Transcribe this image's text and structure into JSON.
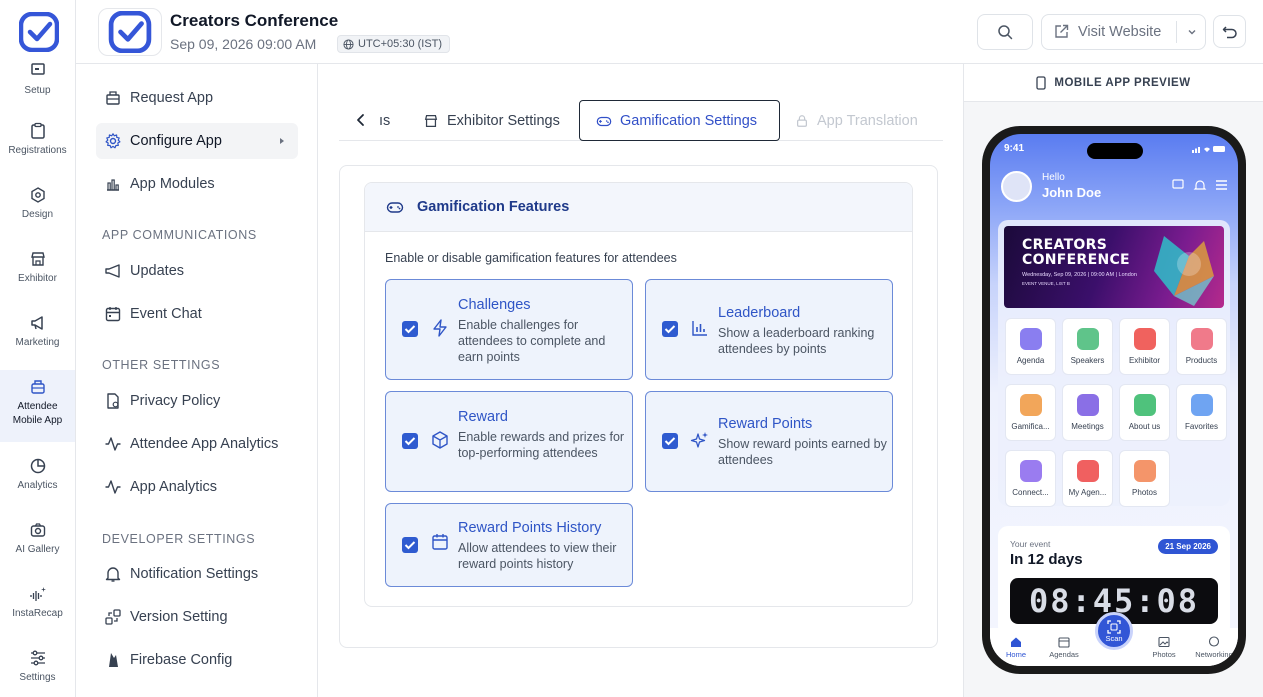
{
  "rail": {
    "items": [
      {
        "label": "Setup",
        "icon": "setup-icon"
      },
      {
        "label": "Registrations",
        "icon": "clipboard-icon"
      },
      {
        "label": "Design",
        "icon": "design-icon"
      },
      {
        "label": "Exhibitor",
        "icon": "store-icon"
      },
      {
        "label": "Marketing",
        "icon": "megaphone-icon"
      },
      {
        "label": "Attendee Mobile App",
        "label_line1": "Attendee",
        "label_line2": "Mobile App",
        "icon": "mobile-app-icon",
        "active": true
      },
      {
        "label": "Analytics",
        "icon": "pie-chart-icon"
      },
      {
        "label": "AI Gallery",
        "icon": "camera-icon"
      },
      {
        "label": "InstaRecap",
        "icon": "sparkle-wave-icon"
      },
      {
        "label": "Settings",
        "icon": "sliders-icon"
      }
    ]
  },
  "header": {
    "event_title": "Creators Conference",
    "event_datetime": "Sep 09, 2026 09:00 AM",
    "timezone": "UTC+05:30 (IST)",
    "visit_website": "Visit Website"
  },
  "nav": {
    "top_items": [
      {
        "label": "Request App",
        "icon": "package-icon"
      },
      {
        "label": "Configure App",
        "icon": "gear-icon",
        "active": true
      },
      {
        "label": "App Modules",
        "icon": "bar-chart-icon"
      }
    ],
    "sections": [
      {
        "title": "APP COMMUNICATIONS",
        "items": [
          {
            "label": "Updates",
            "icon": "megaphone-icon"
          },
          {
            "label": "Event Chat",
            "icon": "calendar-icon"
          }
        ]
      },
      {
        "title": "OTHER SETTINGS",
        "items": [
          {
            "label": "Privacy Policy",
            "icon": "document-icon"
          },
          {
            "label": "Attendee App Analytics",
            "icon": "activity-icon"
          },
          {
            "label": "App Analytics",
            "icon": "activity-icon"
          }
        ]
      },
      {
        "title": "DEVELOPER SETTINGS",
        "items": [
          {
            "label": "Notification Settings",
            "icon": "bell-icon"
          },
          {
            "label": "Version Setting",
            "icon": "version-icon"
          },
          {
            "label": "Firebase Config",
            "icon": "flame-icon"
          }
        ]
      }
    ]
  },
  "tabs": {
    "partial": "ıs",
    "exhibitor": "Exhibitor Settings",
    "gamification": "Gamification Settings",
    "translation": "App Translation"
  },
  "gamification": {
    "title": "Gamification Features",
    "description": "Enable or disable gamification features for attendees",
    "features": [
      {
        "title": "Challenges",
        "desc": "Enable challenges for attendees to complete and earn points",
        "checked": true,
        "icon": "lightning-icon"
      },
      {
        "title": "Leaderboard",
        "desc": "Show a leaderboard ranking attendees by points",
        "checked": true,
        "icon": "bar-chart-icon"
      },
      {
        "title": "Reward",
        "desc": "Enable rewards and prizes for top-performing attendees",
        "checked": true,
        "icon": "box-icon"
      },
      {
        "title": "Reward Points",
        "desc": "Show reward points earned by attendees",
        "checked": true,
        "icon": "sparkles-icon"
      },
      {
        "title": "Reward Points History",
        "desc": "Allow attendees to view their reward points history",
        "checked": true,
        "icon": "calendar-icon"
      }
    ]
  },
  "preview": {
    "title": "MOBILE APP PREVIEW",
    "phone": {
      "time": "9:41",
      "greeting": "Hello",
      "user_name": "John Doe",
      "banner_line1": "CREATORS",
      "banner_line2": "CONFERENCE",
      "banner_date": "Wednesday, Sep 09, 2026 | 09:00 AM | London",
      "banner_extra": "EVENT VENUE, LIST B",
      "modules": [
        "Agenda",
        "Speakers",
        "Exhibitor",
        "Products",
        "Gamifica...",
        "Meetings",
        "About us",
        "Favorites",
        "Connect...",
        "My Agen...",
        "Photos"
      ],
      "your_event": "Your event",
      "countdown_label": "In 12 days",
      "event_date_pill": "21 Sep 2026",
      "countdown": "08:45:08",
      "tabbar": [
        "Home",
        "Agendas",
        "Scan",
        "Photos",
        "Networking"
      ]
    }
  },
  "colors": {
    "accent": "#2f55c6",
    "checkbox": "#2f5bd0",
    "card_bg": "#eef3fc",
    "card_border": "#6b8ad8"
  }
}
